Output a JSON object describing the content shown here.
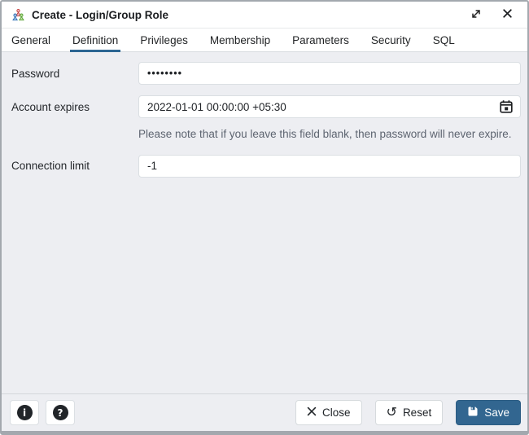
{
  "window": {
    "title": "Create - Login/Group Role"
  },
  "tabs": [
    {
      "label": "General",
      "active": false
    },
    {
      "label": "Definition",
      "active": true
    },
    {
      "label": "Privileges",
      "active": false
    },
    {
      "label": "Membership",
      "active": false
    },
    {
      "label": "Parameters",
      "active": false
    },
    {
      "label": "Security",
      "active": false
    },
    {
      "label": "SQL",
      "active": false
    }
  ],
  "form": {
    "password": {
      "label": "Password",
      "value": "••••••••"
    },
    "account_expires": {
      "label": "Account expires",
      "value": "2022-01-01 00:00:00 +05:30",
      "help_text": "Please note that if you leave this field blank, then password will never expire."
    },
    "connection_limit": {
      "label": "Connection limit",
      "value": "-1"
    }
  },
  "footer": {
    "close_label": "Close",
    "reset_label": "Reset",
    "save_label": "Save"
  },
  "glyphs": {
    "info": "i",
    "help": "?",
    "reset": "↺"
  },
  "colors": {
    "accent": "#326690",
    "content_bg": "#edeef2",
    "helper_text": "#5d6470",
    "border": "#dbdfe3"
  }
}
